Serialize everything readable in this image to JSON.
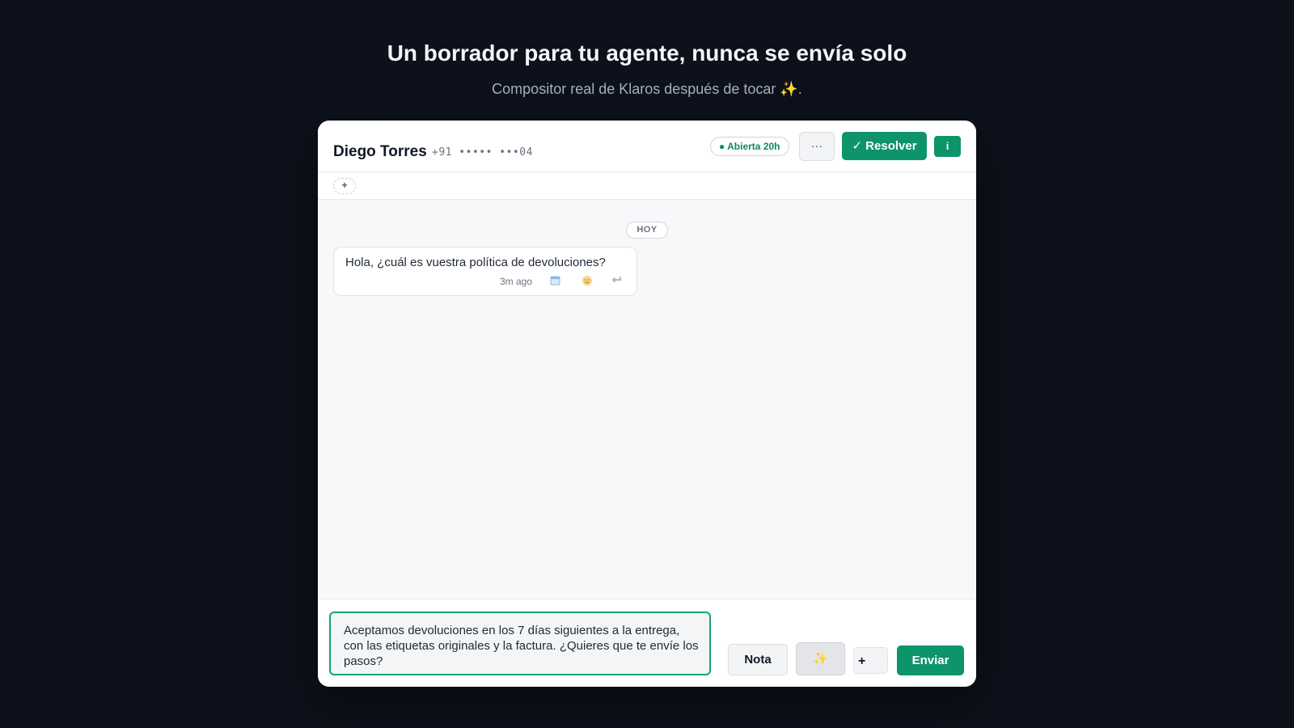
{
  "hero": {
    "title": "Un borrador para tu agente, nunca se envía solo",
    "subtitle": "Compositor real de Klaros después de tocar",
    "subtitle_icon": "✨",
    "subtitle_end": "."
  },
  "header": {
    "contact_name": "Diego Torres",
    "contact_phone": "+91 ••••• •••04",
    "status": "● Abierta 20h",
    "more_label": "···",
    "resolve_label": "✓ Resolver",
    "info_label": "i"
  },
  "tagbar": {
    "add_label": "+"
  },
  "messages": {
    "date_separator": "HOY",
    "items": [
      {
        "text": "Hola, ¿cuál es vuestra política de devoluciones?",
        "time": "3m ago",
        "icons": [
          "calendar-icon",
          "emoji-icon",
          "reply-icon"
        ]
      }
    ]
  },
  "composer": {
    "draft": "Aceptamos devoluciones en los 7 días siguientes a la entrega, con las etiquetas originales y la factura. ¿Quieres que te envíe los pasos?",
    "note_label": "Nota",
    "ai_label": "✨",
    "plus_label": "+",
    "send_label": "Enviar"
  },
  "colors": {
    "background": "#0d111b",
    "accent": "#0e946a",
    "status_text": "#0e8a5f"
  }
}
